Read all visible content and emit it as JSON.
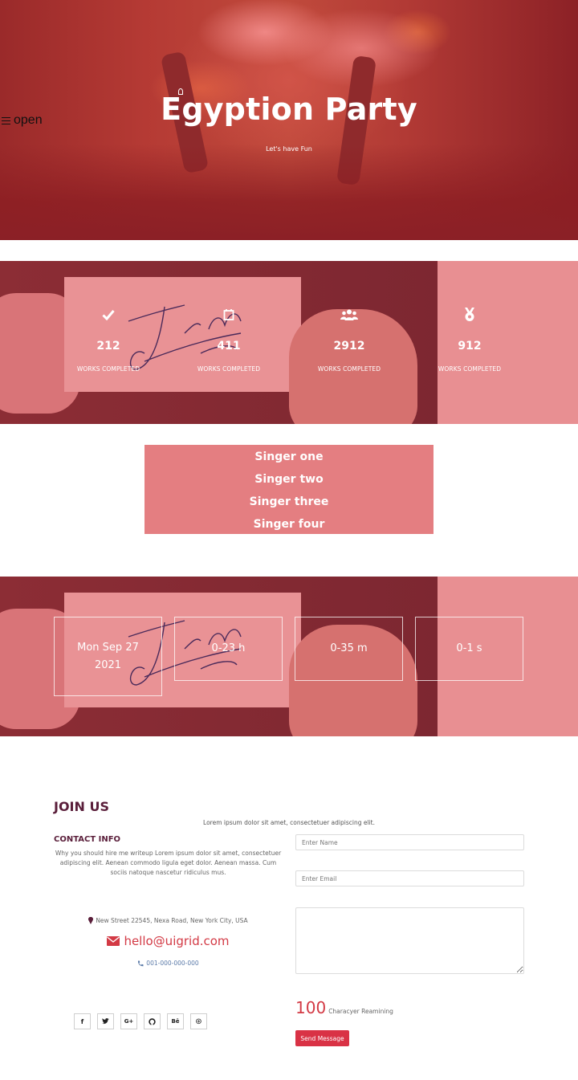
{
  "hero": {
    "menu_label": "open",
    "title": "Egyption Party",
    "subtitle": "Let's have Fun"
  },
  "stats": [
    {
      "icon": "check-icon",
      "value": "212",
      "label": "WORKS COMPLETED"
    },
    {
      "icon": "calendar-icon",
      "value": "411",
      "label": "WORKS COMPLETED"
    },
    {
      "icon": "users-icon",
      "value": "2912",
      "label": "WORKS COMPLETED"
    },
    {
      "icon": "medal-icon",
      "value": "912",
      "label": "WORKS COMPLETED"
    }
  ],
  "singers": [
    "Singer one",
    "Singer two",
    "Singer three",
    "Singer four"
  ],
  "countdown": {
    "date_line1": "Mon Sep 27",
    "date_line2": "2021",
    "hours": "0-23 h",
    "minutes": "0-35 m",
    "seconds": "0-1 s"
  },
  "contact": {
    "join_title": "JOIN US",
    "join_subtitle": "Lorem ipsum dolor sit amet, consectetuer adipiscing elit.",
    "info_title": "CONTACT INFO",
    "info_text": "Why you should hire me writeup Lorem ipsum dolor sit amet, consectetuer adipiscing elit. Aenean commodo ligula eget dolor. Aenean massa. Cum sociis natoque nascetur ridiculus mus.",
    "address": "New Street 22545, Nexa Road, New York City, USA",
    "email": "hello@uigrid.com",
    "phone": "001-000-000-000",
    "socials": [
      {
        "name": "facebook",
        "glyph": "f"
      },
      {
        "name": "twitter",
        "glyph": "🐦"
      },
      {
        "name": "google-plus",
        "glyph": "G+"
      },
      {
        "name": "github",
        "glyph": "◯"
      },
      {
        "name": "behance",
        "glyph": "Bē"
      },
      {
        "name": "dribbble",
        "glyph": "⊛"
      }
    ]
  },
  "form": {
    "name_placeholder": "Enter Name",
    "email_placeholder": "Enter Email",
    "message_value": "",
    "remaining_count": "100",
    "remaining_text": "Characyer Reamining",
    "send_label": "Send Message"
  },
  "colors": {
    "accent": "#d93245",
    "heading": "#5a1e3a",
    "singers_bg": "#e47e81",
    "band_pink": "#e88f92"
  }
}
